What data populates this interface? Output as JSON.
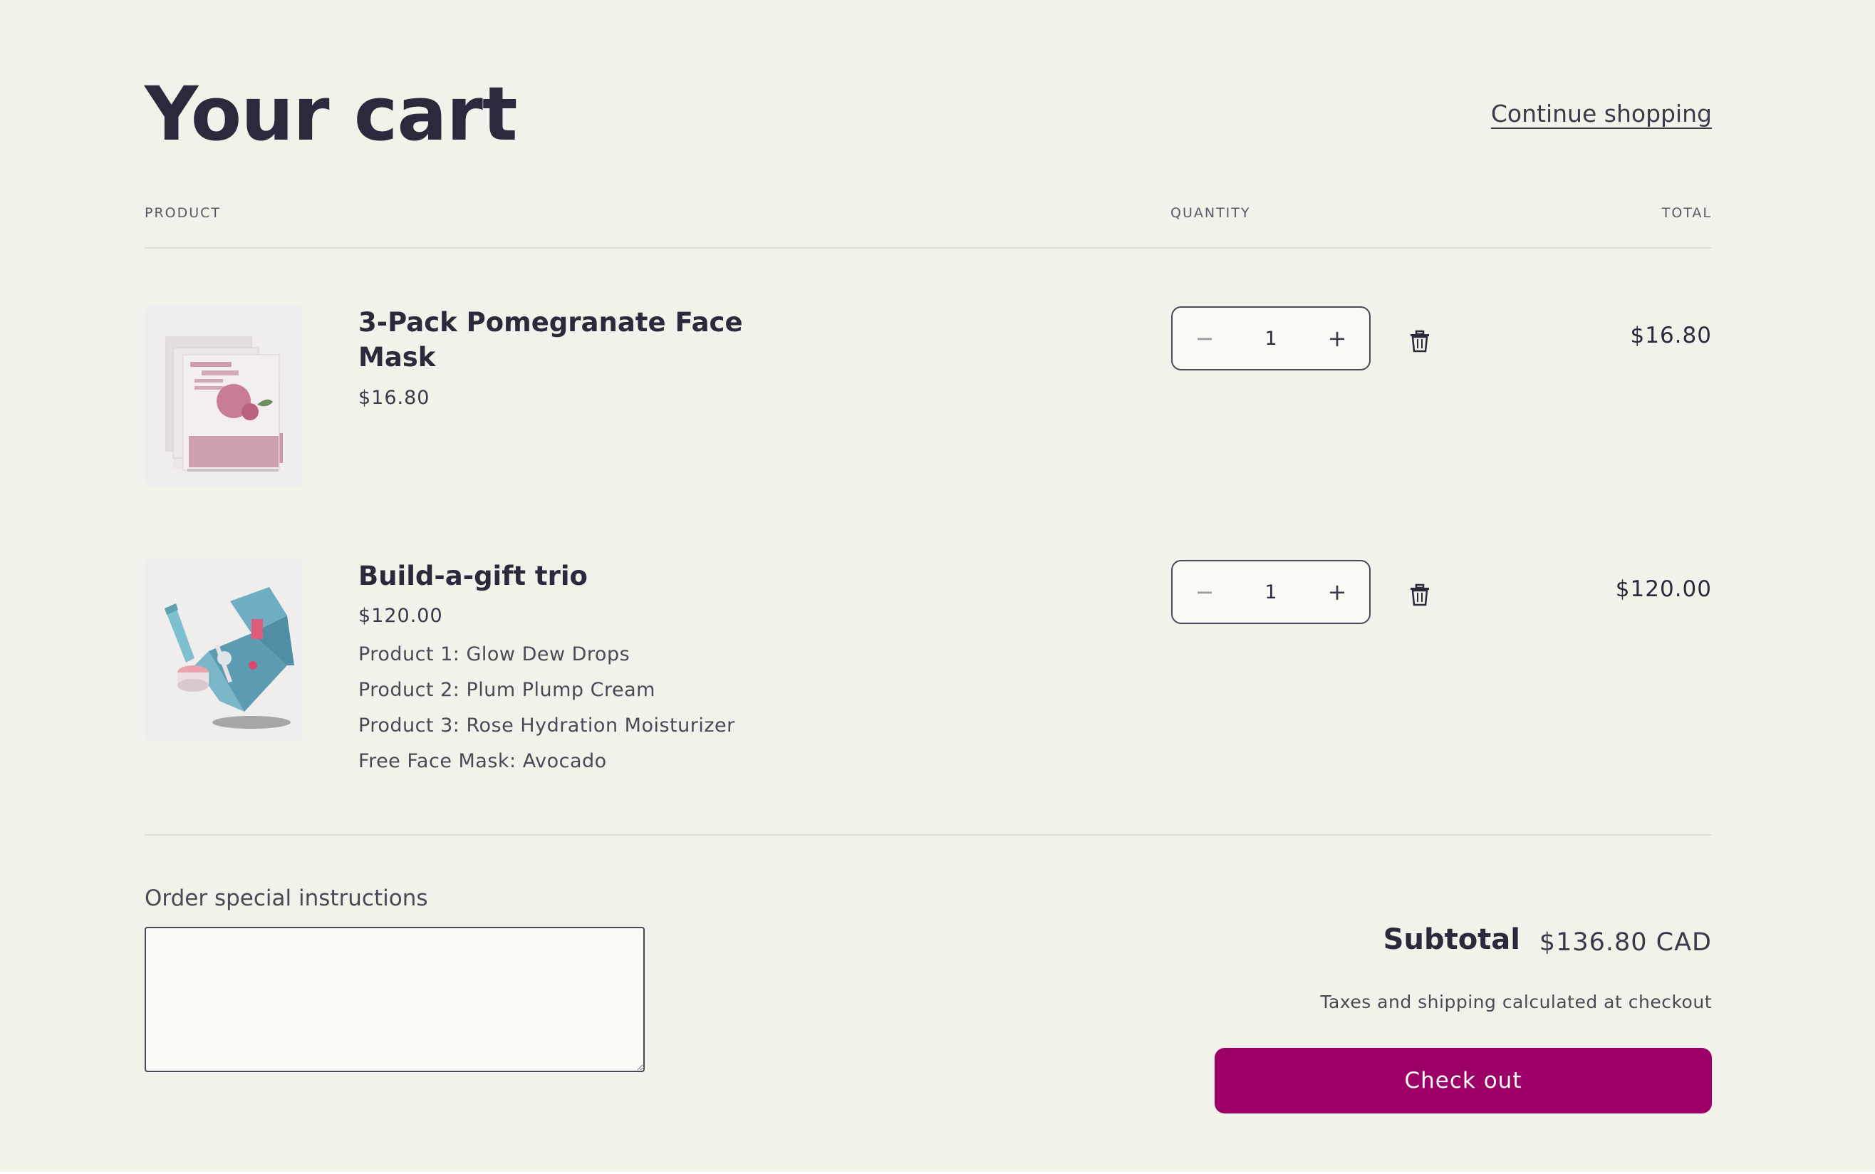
{
  "header": {
    "title": "Your cart",
    "continue_label": "Continue shopping"
  },
  "columns": {
    "product": "PRODUCT",
    "quantity": "QUANTITY",
    "total": "TOTAL"
  },
  "items": [
    {
      "name": "3-Pack Pomegranate Face Mask",
      "price": "$16.80",
      "quantity": "1",
      "total": "$16.80",
      "options": [],
      "image_icon": "pomegranate-mask-pack-image"
    },
    {
      "name": "Build-a-gift trio",
      "price": "$120.00",
      "quantity": "1",
      "total": "$120.00",
      "options": [
        "Product 1: Glow Dew Drops",
        "Product 2: Plum Plump Cream",
        "Product 3: Rose Hydration Moisturizer",
        "Free Face Mask: Avocado"
      ],
      "image_icon": "gift-box-image"
    }
  ],
  "quantity_controls": {
    "decrease_icon": "minus-icon",
    "increase_icon": "plus-icon",
    "remove_icon": "trash-icon"
  },
  "footer": {
    "instructions_label": "Order special instructions",
    "instructions_value": "",
    "subtotal_label": "Subtotal",
    "subtotal_value": "$136.80 CAD",
    "tax_note": "Taxes and shipping calculated at checkout",
    "checkout_label": "Check out"
  },
  "colors": {
    "background": "#f2f1ea",
    "text": "#2b2a3c",
    "accent": "#9c0067"
  }
}
